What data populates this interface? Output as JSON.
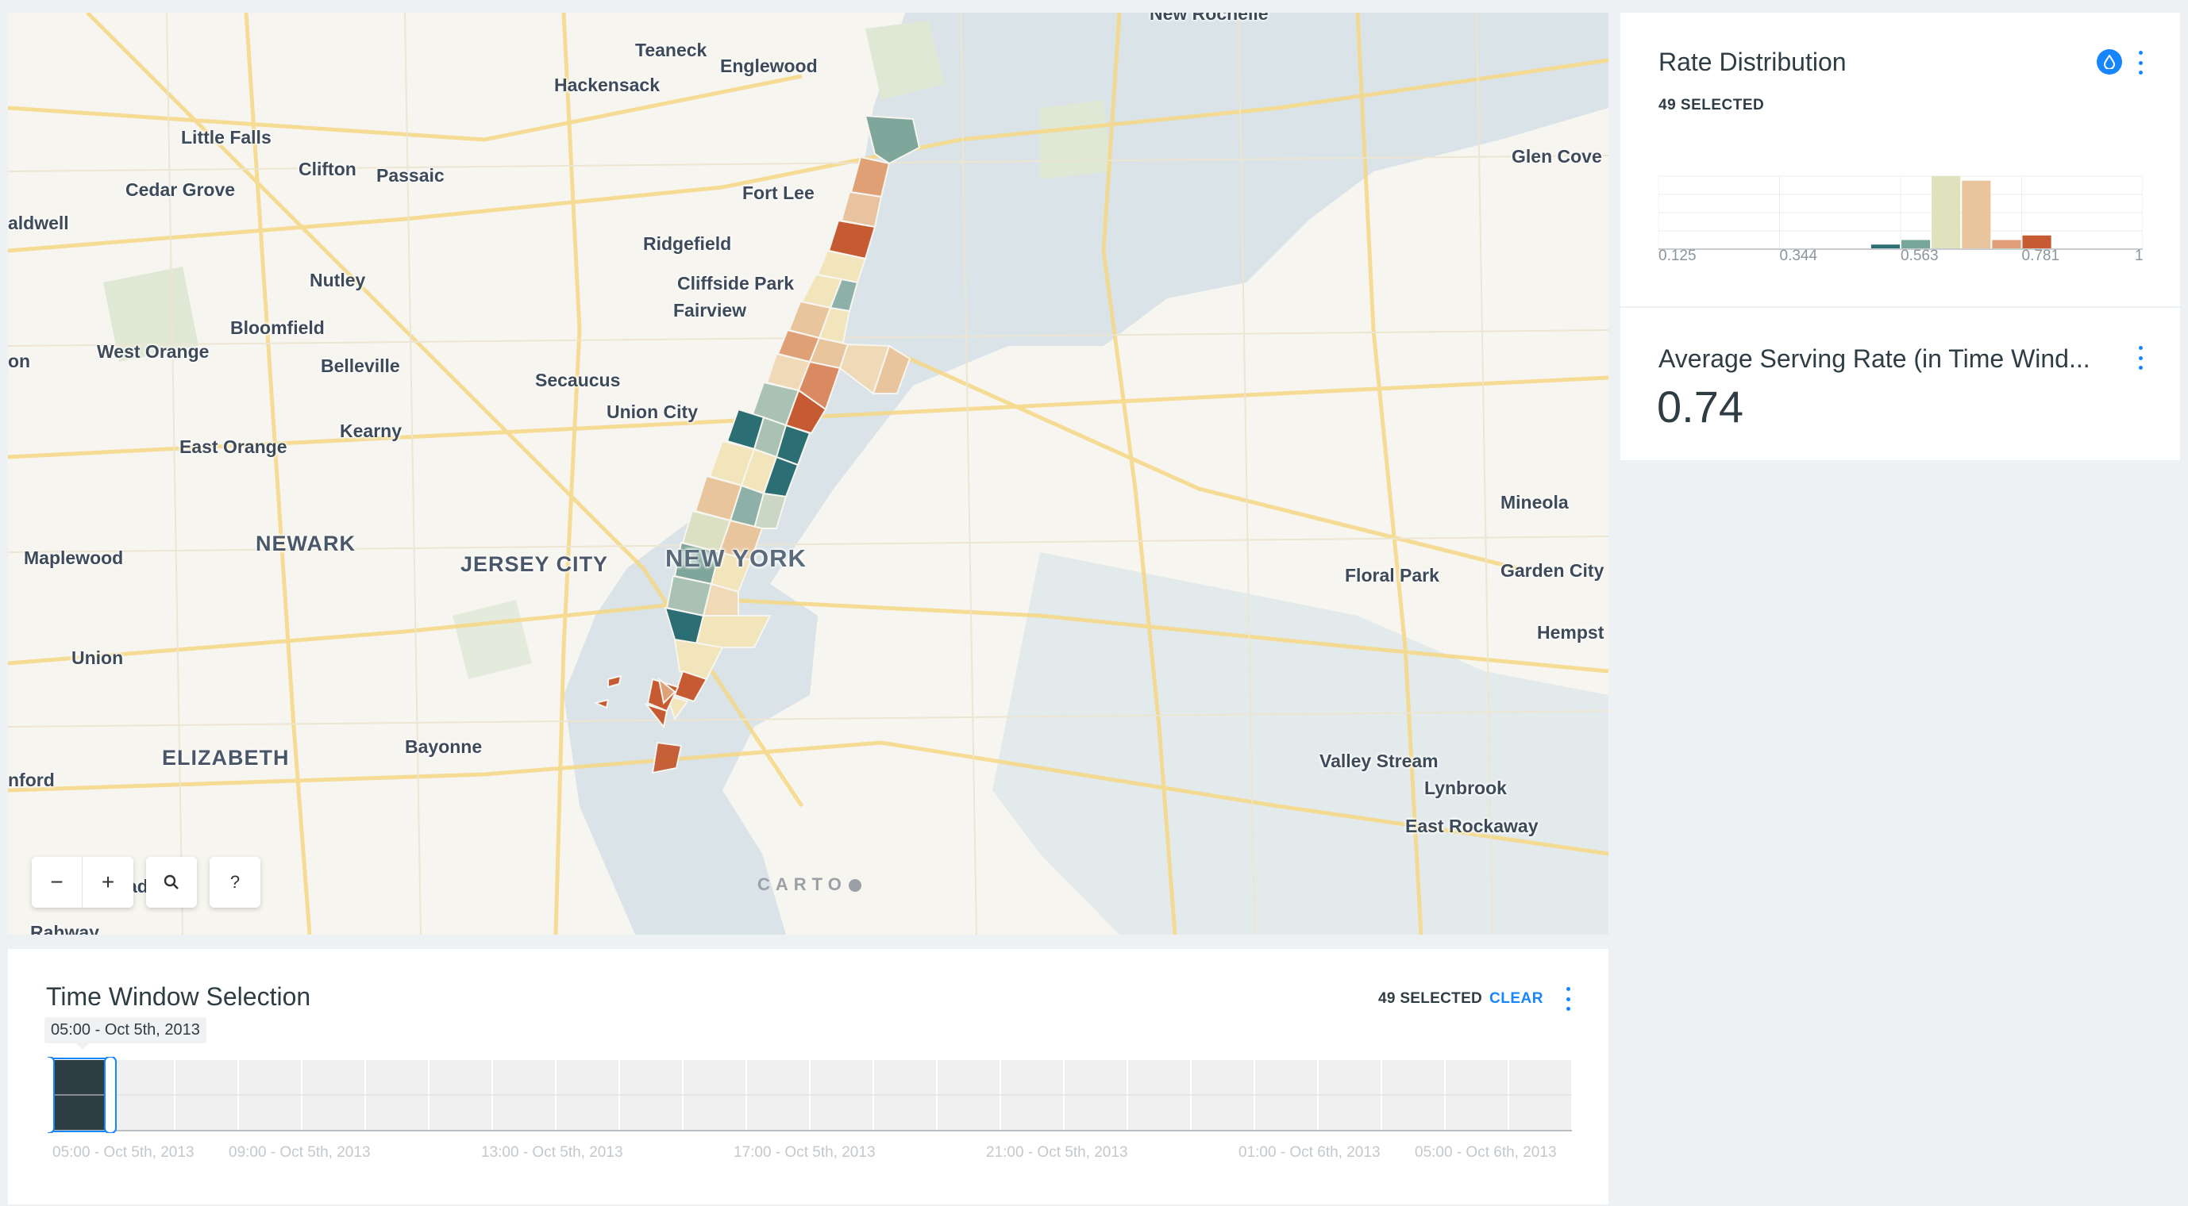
{
  "map": {
    "labels": [
      {
        "text": "Teaneck",
        "cls": ""
      },
      {
        "text": "Englewood",
        "cls": ""
      },
      {
        "text": "Hackensack",
        "cls": ""
      },
      {
        "text": "Little Falls",
        "cls": ""
      },
      {
        "text": "Clifton",
        "cls": ""
      },
      {
        "text": "Passaic",
        "cls": ""
      },
      {
        "text": "Cedar Grove",
        "cls": ""
      },
      {
        "text": "Fort Lee",
        "cls": ""
      },
      {
        "text": "aldwell",
        "cls": ""
      },
      {
        "text": "Ridgefield",
        "cls": ""
      },
      {
        "text": "Nutley",
        "cls": ""
      },
      {
        "text": "Cliffside Park",
        "cls": ""
      },
      {
        "text": "Fairview",
        "cls": ""
      },
      {
        "text": "Bloomfield",
        "cls": ""
      },
      {
        "text": "West Orange",
        "cls": ""
      },
      {
        "text": "Belleville",
        "cls": ""
      },
      {
        "text": "Secaucus",
        "cls": ""
      },
      {
        "text": "Union City",
        "cls": ""
      },
      {
        "text": "East Orange",
        "cls": ""
      },
      {
        "text": "Kearny",
        "cls": ""
      },
      {
        "text": "NEWARK",
        "cls": "city"
      },
      {
        "text": "Maplewood",
        "cls": ""
      },
      {
        "text": "JERSEY CITY",
        "cls": "city"
      },
      {
        "text": "NEW YORK",
        "cls": "big"
      },
      {
        "text": "Union",
        "cls": ""
      },
      {
        "text": "ELIZABETH",
        "cls": "city"
      },
      {
        "text": "Bayonne",
        "cls": ""
      },
      {
        "text": "nford",
        "cls": ""
      },
      {
        "text": "Glen Cove",
        "cls": ""
      },
      {
        "text": "Mineola",
        "cls": ""
      },
      {
        "text": "Floral Park",
        "cls": ""
      },
      {
        "text": "Garden City",
        "cls": ""
      },
      {
        "text": "Hempst",
        "cls": ""
      },
      {
        "text": "Valley Stream",
        "cls": ""
      },
      {
        "text": "Lynbrook",
        "cls": ""
      },
      {
        "text": "East Rockaway",
        "cls": ""
      },
      {
        "text": "on",
        "cls": ""
      },
      {
        "text": "ad",
        "cls": ""
      },
      {
        "text": "Rahway",
        "cls": ""
      },
      {
        "text": "New Rochelle",
        "cls": ""
      }
    ],
    "controls": {
      "zoom_out": "−",
      "zoom_in": "+",
      "help": "?"
    },
    "attribution": "CARTO"
  },
  "rate_distribution": {
    "title": "Rate Distribution",
    "selected": "49 SELECTED",
    "x_ticks": [
      "0.125",
      "0.344",
      "0.563",
      "0.781",
      "1"
    ],
    "colors": {
      "accent": "#1785fb"
    }
  },
  "chart_data": {
    "type": "bar",
    "title": "Rate Distribution",
    "categories": [
      "0.125-0.180",
      "0.180-0.235",
      "0.235-0.289",
      "0.289-0.344",
      "0.344-0.399",
      "0.399-0.453",
      "0.453-0.508",
      "0.508-0.563",
      "0.563-0.617",
      "0.617-0.672",
      "0.672-0.727",
      "0.727-0.781",
      "0.781-0.836",
      "0.836-0.891",
      "0.891-0.945",
      "0.945-1"
    ],
    "values": [
      0,
      0,
      0,
      0,
      0,
      0,
      0,
      0,
      1,
      0,
      0,
      1,
      0,
      0,
      0,
      0
    ],
    "series": [
      {
        "values": [
          0,
          0,
          0,
          0,
          0,
          0,
          0,
          1,
          2,
          16,
          15,
          2,
          3,
          0,
          0,
          0
        ]
      }
    ],
    "colors": [
      "#e6e6e6",
      "#e6e6e6",
      "#e6e6e6",
      "#e6e6e6",
      "#e6e6e6",
      "#e6e6e6",
      "#e6e6e6",
      "#2b6e73",
      "#76a79a",
      "#dfe3bd",
      "#e8c59c",
      "#e09d78",
      "#c65a32",
      "#c65a32",
      "#c65a32",
      "#c65a32"
    ],
    "xlim": [
      0.125,
      1
    ],
    "ylim": [
      0,
      16
    ],
    "grid": true
  },
  "avg_rate": {
    "title": "Average Serving Rate (in Time Wind...",
    "value": "0.74"
  },
  "time_window": {
    "title": "Time Window Selection",
    "selected": "49 SELECTED",
    "clear": "CLEAR",
    "tooltip": "05:00 - Oct 5th, 2013",
    "axis": [
      "05:00 - Oct 5th, 2013",
      "09:00 - Oct 5th, 2013",
      "13:00 - Oct 5th, 2013",
      "17:00 - Oct 5th, 2013",
      "21:00 - Oct 5th, 2013",
      "01:00 - Oct 6th, 2013",
      "05:00 - Oct 6th, 2013"
    ],
    "bins": 24,
    "selected_bin": 0,
    "colors": {
      "selected": "#2e3c43",
      "bar": "#f0f0f0",
      "border": "#1785fb"
    }
  }
}
